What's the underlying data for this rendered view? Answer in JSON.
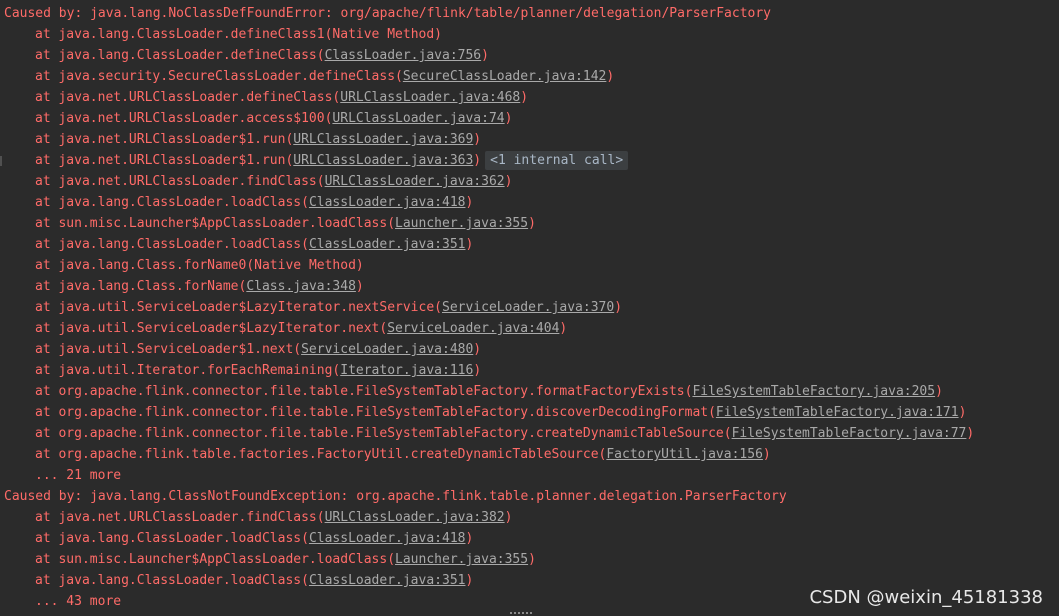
{
  "lines": [
    {
      "kind": "cause",
      "text": "Caused by: java.lang.NoClassDefFoundError: org/apache/flink/table/planner/delegation/ParserFactory"
    },
    {
      "kind": "frame",
      "method": "at java.lang.ClassLoader.defineClass1",
      "source": "Native Method",
      "link": false
    },
    {
      "kind": "frame",
      "method": "at java.lang.ClassLoader.defineClass",
      "source": "ClassLoader.java:756",
      "link": true
    },
    {
      "kind": "frame",
      "method": "at java.security.SecureClassLoader.defineClass",
      "source": "SecureClassLoader.java:142",
      "link": true
    },
    {
      "kind": "frame",
      "method": "at java.net.URLClassLoader.defineClass",
      "source": "URLClassLoader.java:468",
      "link": true
    },
    {
      "kind": "frame",
      "method": "at java.net.URLClassLoader.access$100",
      "source": "URLClassLoader.java:74",
      "link": true
    },
    {
      "kind": "frame",
      "method": "at java.net.URLClassLoader$1.run",
      "source": "URLClassLoader.java:369",
      "link": true
    },
    {
      "kind": "frame",
      "method": "at java.net.URLClassLoader$1.run",
      "source": "URLClassLoader.java:363",
      "link": true,
      "hint": "<1 internal call>",
      "gutter": true
    },
    {
      "kind": "frame",
      "method": "at java.net.URLClassLoader.findClass",
      "source": "URLClassLoader.java:362",
      "link": true
    },
    {
      "kind": "frame",
      "method": "at java.lang.ClassLoader.loadClass",
      "source": "ClassLoader.java:418",
      "link": true
    },
    {
      "kind": "frame",
      "method": "at sun.misc.Launcher$AppClassLoader.loadClass",
      "source": "Launcher.java:355",
      "link": true
    },
    {
      "kind": "frame",
      "method": "at java.lang.ClassLoader.loadClass",
      "source": "ClassLoader.java:351",
      "link": true
    },
    {
      "kind": "frame",
      "method": "at java.lang.Class.forName0",
      "source": "Native Method",
      "link": false
    },
    {
      "kind": "frame",
      "method": "at java.lang.Class.forName",
      "source": "Class.java:348",
      "link": true
    },
    {
      "kind": "frame",
      "method": "at java.util.ServiceLoader$LazyIterator.nextService",
      "source": "ServiceLoader.java:370",
      "link": true
    },
    {
      "kind": "frame",
      "method": "at java.util.ServiceLoader$LazyIterator.next",
      "source": "ServiceLoader.java:404",
      "link": true
    },
    {
      "kind": "frame",
      "method": "at java.util.ServiceLoader$1.next",
      "source": "ServiceLoader.java:480",
      "link": true
    },
    {
      "kind": "frame",
      "method": "at java.util.Iterator.forEachRemaining",
      "source": "Iterator.java:116",
      "link": true
    },
    {
      "kind": "frame",
      "method": "at org.apache.flink.connector.file.table.FileSystemTableFactory.formatFactoryExists",
      "source": "FileSystemTableFactory.java:205",
      "link": true
    },
    {
      "kind": "frame",
      "method": "at org.apache.flink.connector.file.table.FileSystemTableFactory.discoverDecodingFormat",
      "source": "FileSystemTableFactory.java:171",
      "link": true
    },
    {
      "kind": "frame",
      "method": "at org.apache.flink.connector.file.table.FileSystemTableFactory.createDynamicTableSource",
      "source": "FileSystemTableFactory.java:77",
      "link": true
    },
    {
      "kind": "frame",
      "method": "at org.apache.flink.table.factories.FactoryUtil.createDynamicTableSource",
      "source": "FactoryUtil.java:156",
      "link": true
    },
    {
      "kind": "more",
      "text": "... 21 more"
    },
    {
      "kind": "cause",
      "text": "Caused by: java.lang.ClassNotFoundException: org.apache.flink.table.planner.delegation.ParserFactory"
    },
    {
      "kind": "frame",
      "method": "at java.net.URLClassLoader.findClass",
      "source": "URLClassLoader.java:382",
      "link": true
    },
    {
      "kind": "frame",
      "method": "at java.lang.ClassLoader.loadClass",
      "source": "ClassLoader.java:418",
      "link": true
    },
    {
      "kind": "frame",
      "method": "at sun.misc.Launcher$AppClassLoader.loadClass",
      "source": "Launcher.java:355",
      "link": true
    },
    {
      "kind": "frame",
      "method": "at java.lang.ClassLoader.loadClass",
      "source": "ClassLoader.java:351",
      "link": true
    },
    {
      "kind": "more",
      "text": "... 43 more"
    }
  ],
  "watermark": "CSDN @weixin_45181338",
  "colors": {
    "background": "#2b2b2b",
    "error_text": "#ff6b68",
    "link": "#a9a9a9",
    "hint_bg": "#3c3f41"
  }
}
